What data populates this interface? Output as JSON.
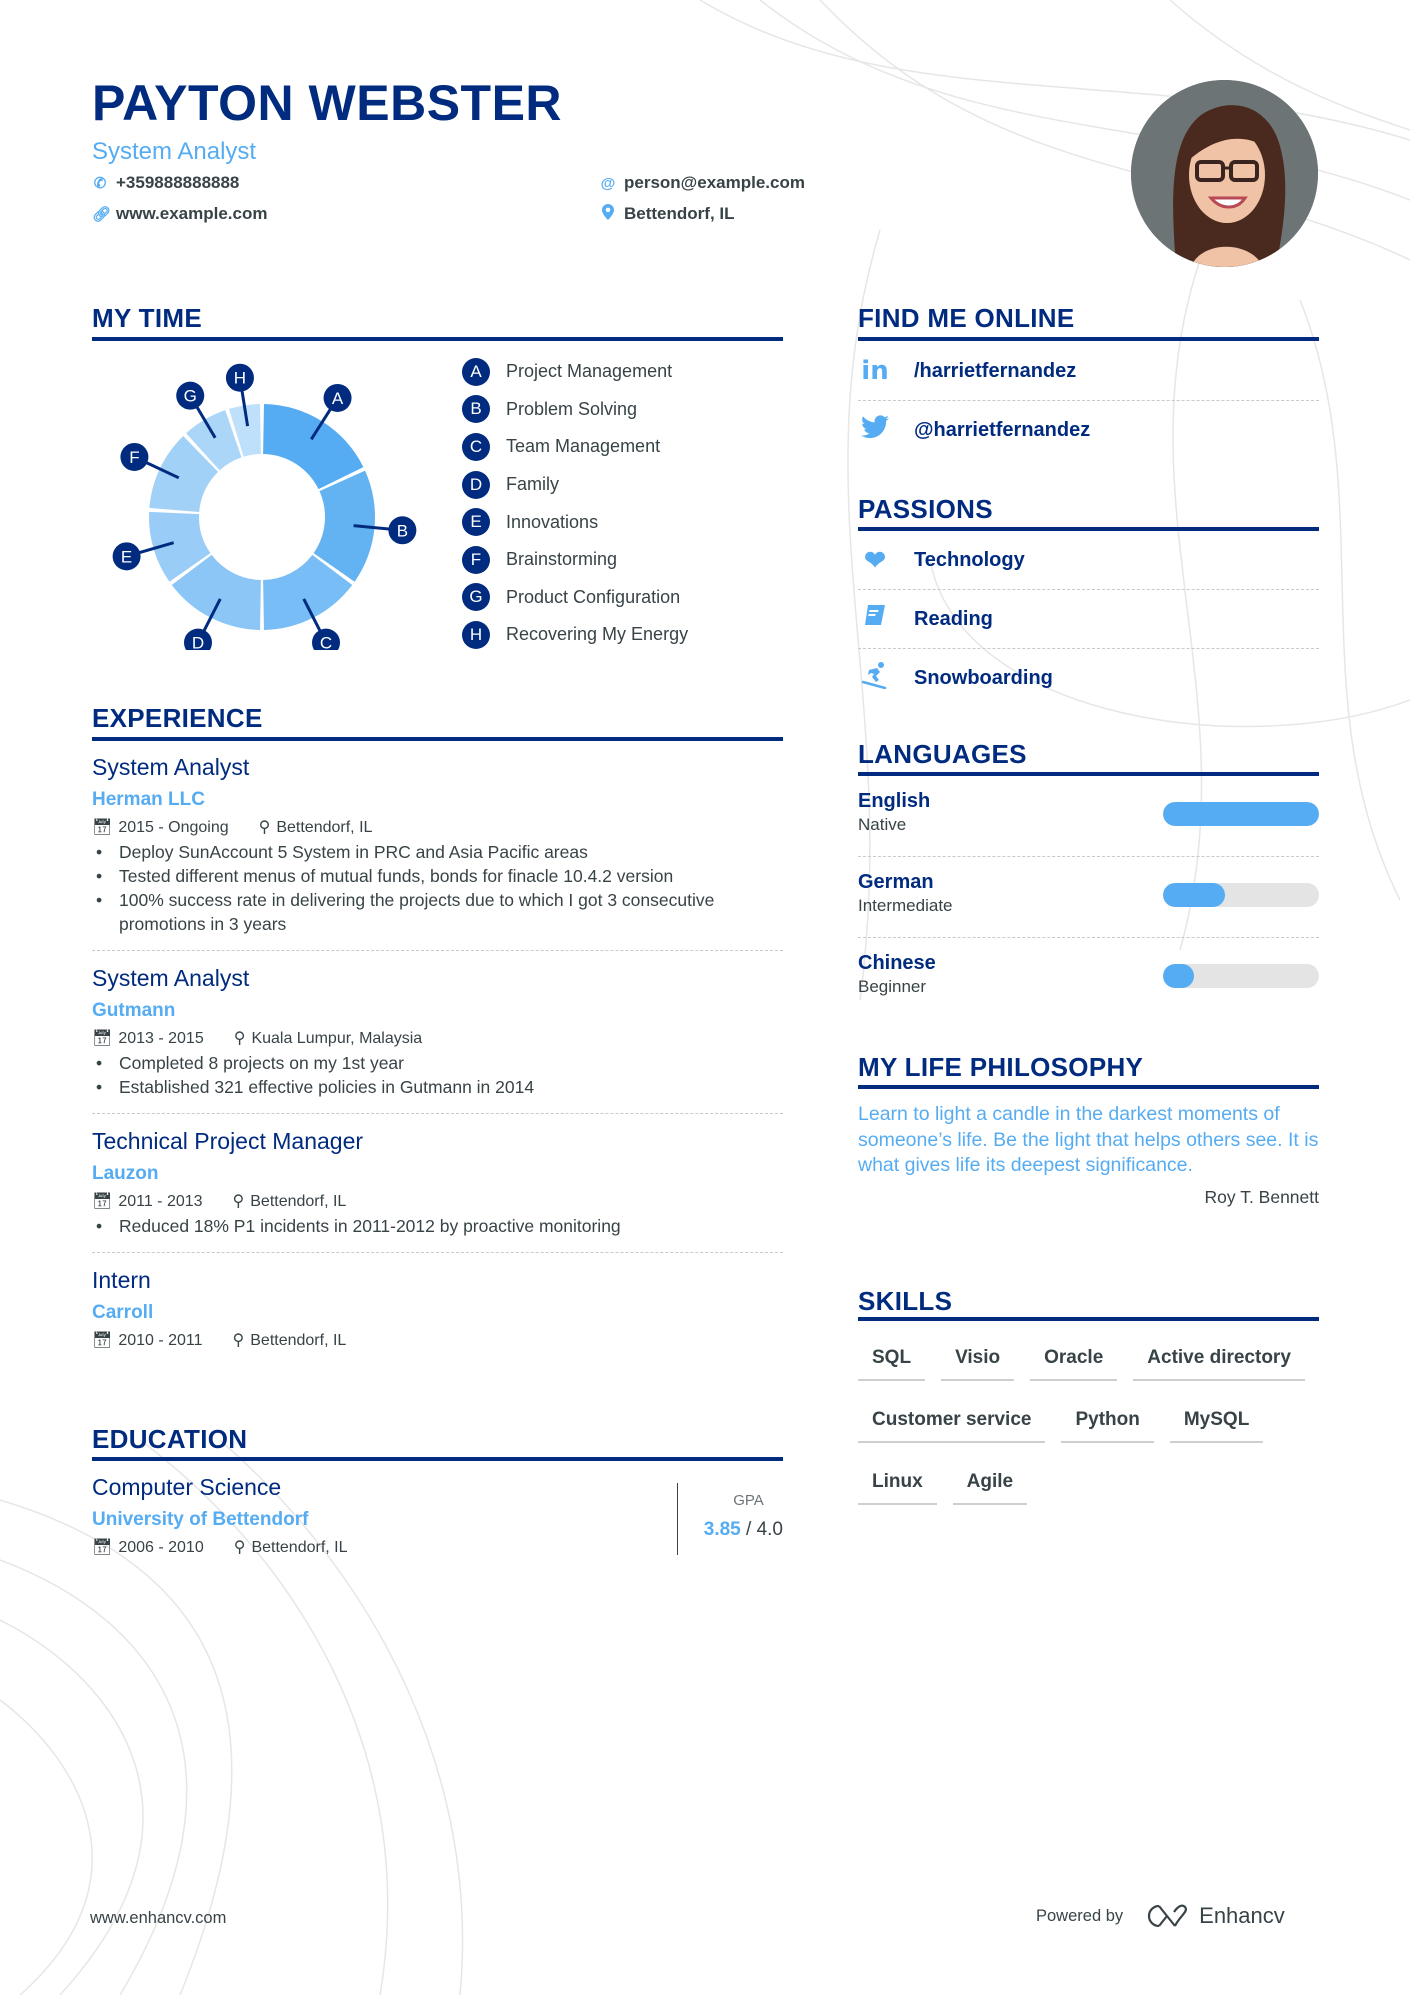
{
  "header": {
    "name": "PAYTON WEBSTER",
    "title": "System Analyst",
    "phone": "+359888888888",
    "email": "person@example.com",
    "website": "www.example.com",
    "location": "Bettendorf, IL"
  },
  "colors": {
    "primary": "#002b7f",
    "accent": "#56acf2",
    "text": "#384347"
  },
  "my_time": {
    "heading": "MY TIME",
    "items": [
      {
        "key": "A",
        "label": "Project Management"
      },
      {
        "key": "B",
        "label": "Problem Solving"
      },
      {
        "key": "C",
        "label": "Team Management"
      },
      {
        "key": "D",
        "label": "Family"
      },
      {
        "key": "E",
        "label": "Innovations"
      },
      {
        "key": "F",
        "label": "Brainstorming"
      },
      {
        "key": "G",
        "label": "Product Configuration"
      },
      {
        "key": "H",
        "label": "Recovering My Energy"
      }
    ]
  },
  "chart_data": {
    "type": "pie",
    "title": "MY TIME",
    "categories": [
      "A",
      "B",
      "C",
      "D",
      "E",
      "F",
      "G",
      "H"
    ],
    "labels": [
      "Project Management",
      "Problem Solving",
      "Team Management",
      "Family",
      "Innovations",
      "Brainstorming",
      "Product Configuration",
      "Recovering My Energy"
    ],
    "values": [
      18,
      17,
      15,
      15,
      11,
      12,
      7,
      5
    ],
    "colors": [
      "#56acf2",
      "#63b3f3",
      "#78bdf5",
      "#8bc6f6",
      "#99cdf7",
      "#a2d1f7",
      "#abd6f8",
      "#bfe0fa"
    ],
    "donut": true,
    "legend": "right"
  },
  "experience": {
    "heading": "EXPERIENCE",
    "jobs": [
      {
        "title": "System Analyst",
        "company": "Herman LLC",
        "dates": "2015 - Ongoing",
        "location": "Bettendorf, IL",
        "bullets": [
          "Deploy SunAccount 5 System in PRC and Asia Pacific areas",
          "Tested different menus of mutual funds, bonds for finacle 10.4.2 version",
          "100% success rate in delivering the projects due to which I got 3 consecutive promotions in 3 years"
        ]
      },
      {
        "title": "System Analyst",
        "company": "Gutmann",
        "dates": "2013 - 2015",
        "location": "Kuala Lumpur, Malaysia",
        "bullets": [
          "Completed 8 projects on my 1st year",
          "Established 321 effective policies in Gutmann in 2014"
        ]
      },
      {
        "title": "Technical Project Manager",
        "company": "Lauzon",
        "dates": "2011 - 2013",
        "location": "Bettendorf, IL",
        "bullets": [
          "Reduced 18% P1 incidents in 2011-2012 by proactive monitoring"
        ]
      },
      {
        "title": "Intern",
        "company": "Carroll",
        "dates": "2010 - 2011",
        "location": "Bettendorf, IL",
        "bullets": []
      }
    ]
  },
  "education": {
    "heading": "EDUCATION",
    "degree": "Computer Science",
    "school": "University of Bettendorf",
    "dates": "2006 - 2010",
    "location": "Bettendorf, IL",
    "gpa_label": "GPA",
    "gpa": "3.85",
    "gpa_max": "/ 4.0"
  },
  "find_me_online": {
    "heading": "FIND ME ONLINE",
    "items": [
      {
        "icon": "linkedin-icon",
        "label": "/harrietfernandez"
      },
      {
        "icon": "twitter-icon",
        "label": "@harrietfernandez"
      }
    ]
  },
  "passions": {
    "heading": "PASSIONS",
    "items": [
      {
        "icon": "heart-icon",
        "label": "Technology"
      },
      {
        "icon": "book-icon",
        "label": "Reading"
      },
      {
        "icon": "snowboarding-icon",
        "label": "Snowboarding"
      }
    ]
  },
  "languages": {
    "heading": "LANGUAGES",
    "items": [
      {
        "name": "English",
        "level": "Native",
        "proficiency": 1.0
      },
      {
        "name": "German",
        "level": "Intermediate",
        "proficiency": 0.4
      },
      {
        "name": "Chinese",
        "level": "Beginner",
        "proficiency": 0.2
      }
    ]
  },
  "philosophy": {
    "heading": "MY LIFE PHILOSOPHY",
    "quote": "Learn to light a candle in the darkest moments of someone’s life. Be the light that helps others see. It is what gives life its deepest significance.",
    "author": "Roy T. Bennett"
  },
  "skills": {
    "heading": "SKILLS",
    "items": [
      "SQL",
      "Visio",
      "Oracle",
      "Active directory",
      "Customer service",
      "Python",
      "MySQL",
      "Linux",
      "Agile"
    ]
  },
  "footer": {
    "website": "www.enhancv.com",
    "powered_by": "Powered by",
    "brand": "Enhancv"
  }
}
